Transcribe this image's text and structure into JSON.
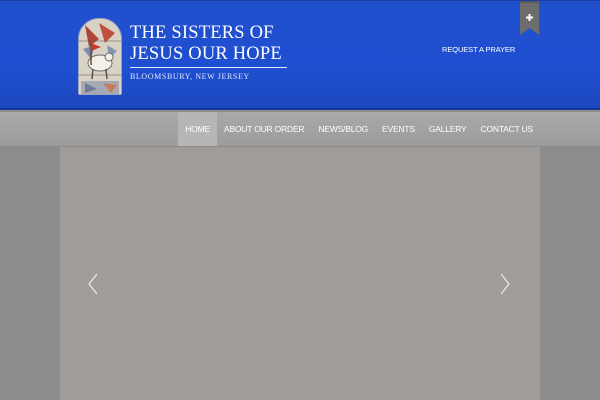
{
  "header": {
    "title_line1": "THE SISTERS OF",
    "title_line2": "JESUS OUR HOPE",
    "subtitle": "BLOOMSBURY, NEW JERSEY",
    "request_link": "REQUEST A PRAYER",
    "ribbon_icon": "plus-icon",
    "logo_icon": "stained-glass-lamb-icon"
  },
  "nav": {
    "items": [
      {
        "label": "HOME",
        "active": true
      },
      {
        "label": "ABOUT OUR ORDER",
        "active": false
      },
      {
        "label": "NEWS/BLOG",
        "active": false
      },
      {
        "label": "EVENTS",
        "active": false
      },
      {
        "label": "GALLERY",
        "active": false
      },
      {
        "label": "CONTACT US",
        "active": false
      }
    ]
  },
  "slider": {
    "prev_icon": "chevron-left-icon",
    "next_icon": "chevron-right-icon"
  },
  "colors": {
    "header_blue": "#1f4fd1",
    "nav_gray": "#a3a3a3",
    "slider_gray": "#9f9c9a"
  }
}
